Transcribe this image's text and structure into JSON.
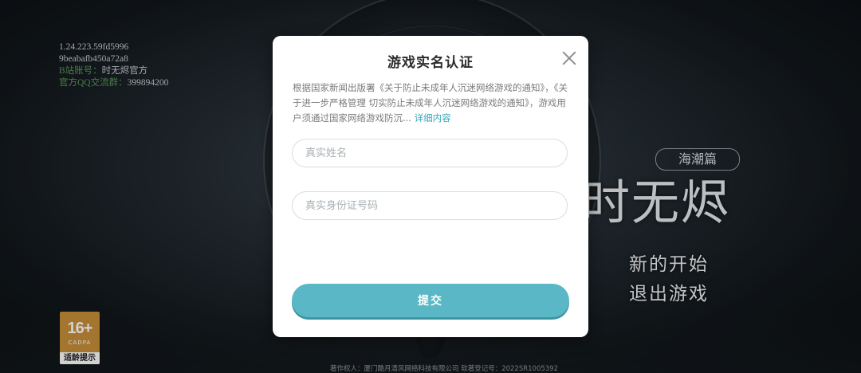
{
  "info": {
    "version": "1.24.223.59fd5996",
    "device_id": "9beabafb450a72a8",
    "bilibili_label": "B站账号：",
    "bilibili_value": "时无烬官方",
    "qq_label": "官方QQ交流群：",
    "qq_value": "399894200"
  },
  "age_badge": {
    "age": "16+",
    "org": "CADPA",
    "tip": "适龄提示"
  },
  "logo": {
    "subtitle": "海潮篇",
    "title": "时无烬"
  },
  "menu": {
    "new_game": "新的开始",
    "exit_game": "退出游戏"
  },
  "copyright": "著作权人：厦门酷月清风网络科技有限公司  软著登记号：2022SR1005392",
  "dialog": {
    "title": "游戏实名认证",
    "notice": "根据国家新闻出版署《关于防止未成年人沉迷网络游戏的通知》，《关于进一步严格管理 切实防止未成年人沉迷网络游戏的通知》，游戏用户须通过国家网络游戏防沉...",
    "more_link": "详细内容",
    "name_placeholder": "真实姓名",
    "id_placeholder": "真实身份证号码",
    "submit_label": "提交"
  },
  "colors": {
    "accent": "#5ab8c6",
    "link": "#3aa8b8",
    "badge": "#c98f3a"
  }
}
